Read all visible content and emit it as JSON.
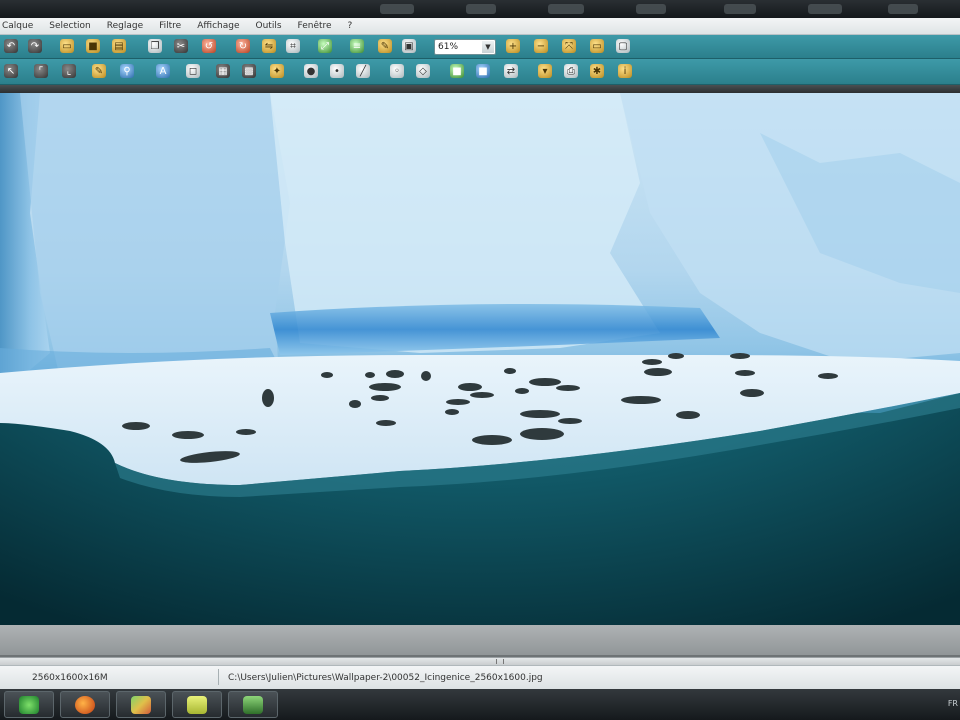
{
  "menu": {
    "items": [
      "Calque",
      "Selection",
      "Reglage",
      "Filtre",
      "Affichage",
      "Outils",
      "Fenêtre",
      "?"
    ]
  },
  "toolbar": {
    "zoom_value": "61%"
  },
  "status": {
    "dimensions": "2560x1600x16M",
    "file_path": "C:\\Users\\Julien\\Pictures\\Wallpaper-2\\00052_Icingenice_2560x1600.jpg"
  },
  "taskbar": {
    "tray_text": "FR"
  },
  "colors": {
    "toolbar": "#2f8593",
    "menubar": "#e9edef",
    "water": "#0d4d5b",
    "ice": "#cfe7f6"
  }
}
